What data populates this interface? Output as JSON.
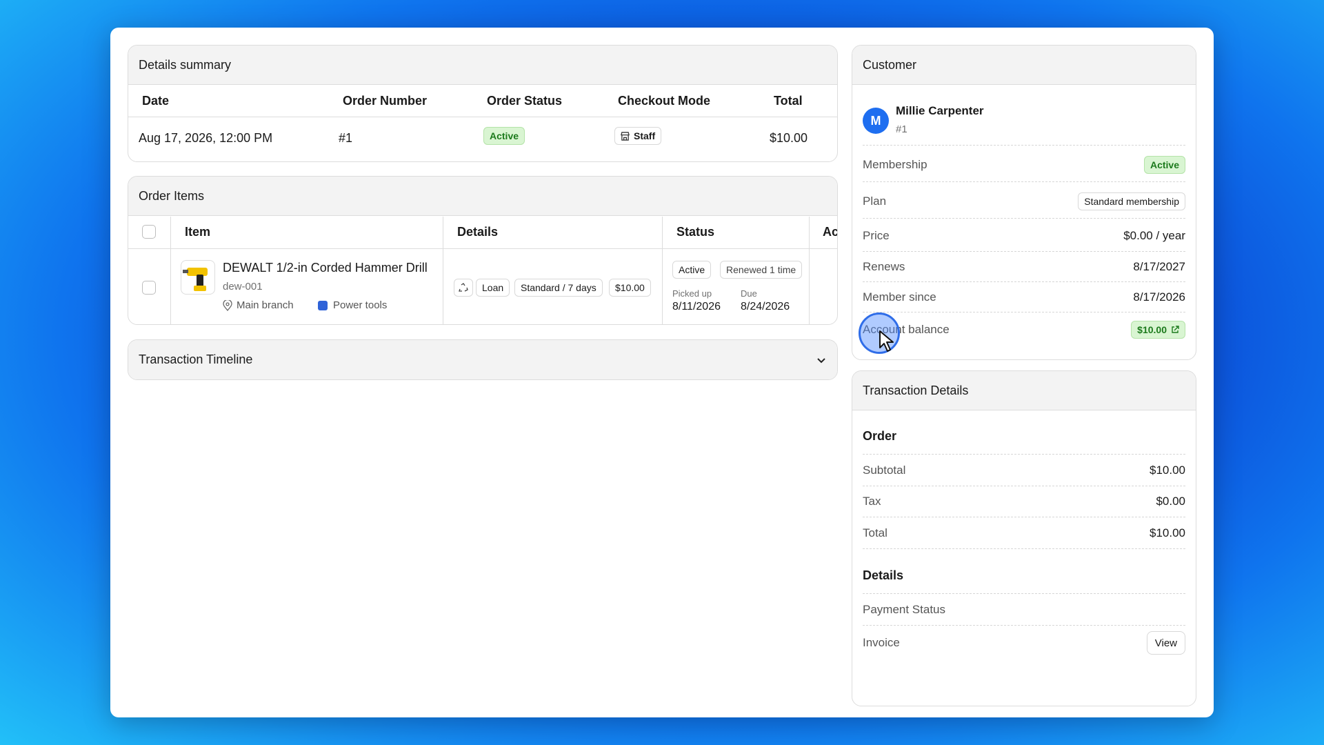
{
  "details_summary": {
    "title": "Details summary",
    "columns": [
      "Date",
      "Order Number",
      "Order Status",
      "Checkout Mode",
      "Total"
    ],
    "row": {
      "date": "Aug 17, 2026, 12:00 PM",
      "order_number": "#1",
      "order_status": "Active",
      "checkout_mode": "Staff",
      "total": "$10.00"
    }
  },
  "order_items": {
    "title": "Order Items",
    "columns": [
      "Item",
      "Details",
      "Status",
      "Ac"
    ],
    "item": {
      "name": "DEWALT 1/2-in Corded Hammer Drill",
      "sku": "dew-001",
      "location": "Main branch",
      "category": "Power tools",
      "category_color": "#2f63d8",
      "details_badges": [
        "Loan",
        "Standard / 7 days",
        "$10.00"
      ],
      "status_badges": [
        "Active",
        "Renewed 1 time"
      ],
      "picked_up_label": "Picked up",
      "picked_up_value": "8/11/2026",
      "due_label": "Due",
      "due_value": "8/24/2026"
    }
  },
  "transaction_timeline": {
    "title": "Transaction Timeline"
  },
  "customer": {
    "title": "Customer",
    "avatar_initial": "M",
    "avatar_color": "#1e6ef0",
    "name": "Millie Carpenter",
    "id": "#1",
    "rows": [
      {
        "label": "Membership",
        "value": "Active"
      },
      {
        "label": "Plan",
        "value": "Standard membership"
      },
      {
        "label": "Price",
        "value": "$0.00 / year"
      },
      {
        "label": "Renews",
        "value": "8/17/2027"
      },
      {
        "label": "Member since",
        "value": "8/17/2026"
      },
      {
        "label": "Account balance",
        "value": "$10.00"
      }
    ]
  },
  "transaction_details": {
    "title": "Transaction Details",
    "order_heading": "Order",
    "order_rows": [
      {
        "label": "Subtotal",
        "value": "$10.00"
      },
      {
        "label": "Tax",
        "value": "$0.00"
      },
      {
        "label": "Total",
        "value": "$10.00"
      }
    ],
    "details_heading": "Details",
    "payment_status_label": "Payment Status",
    "invoice_label": "Invoice",
    "view_button": "View"
  }
}
